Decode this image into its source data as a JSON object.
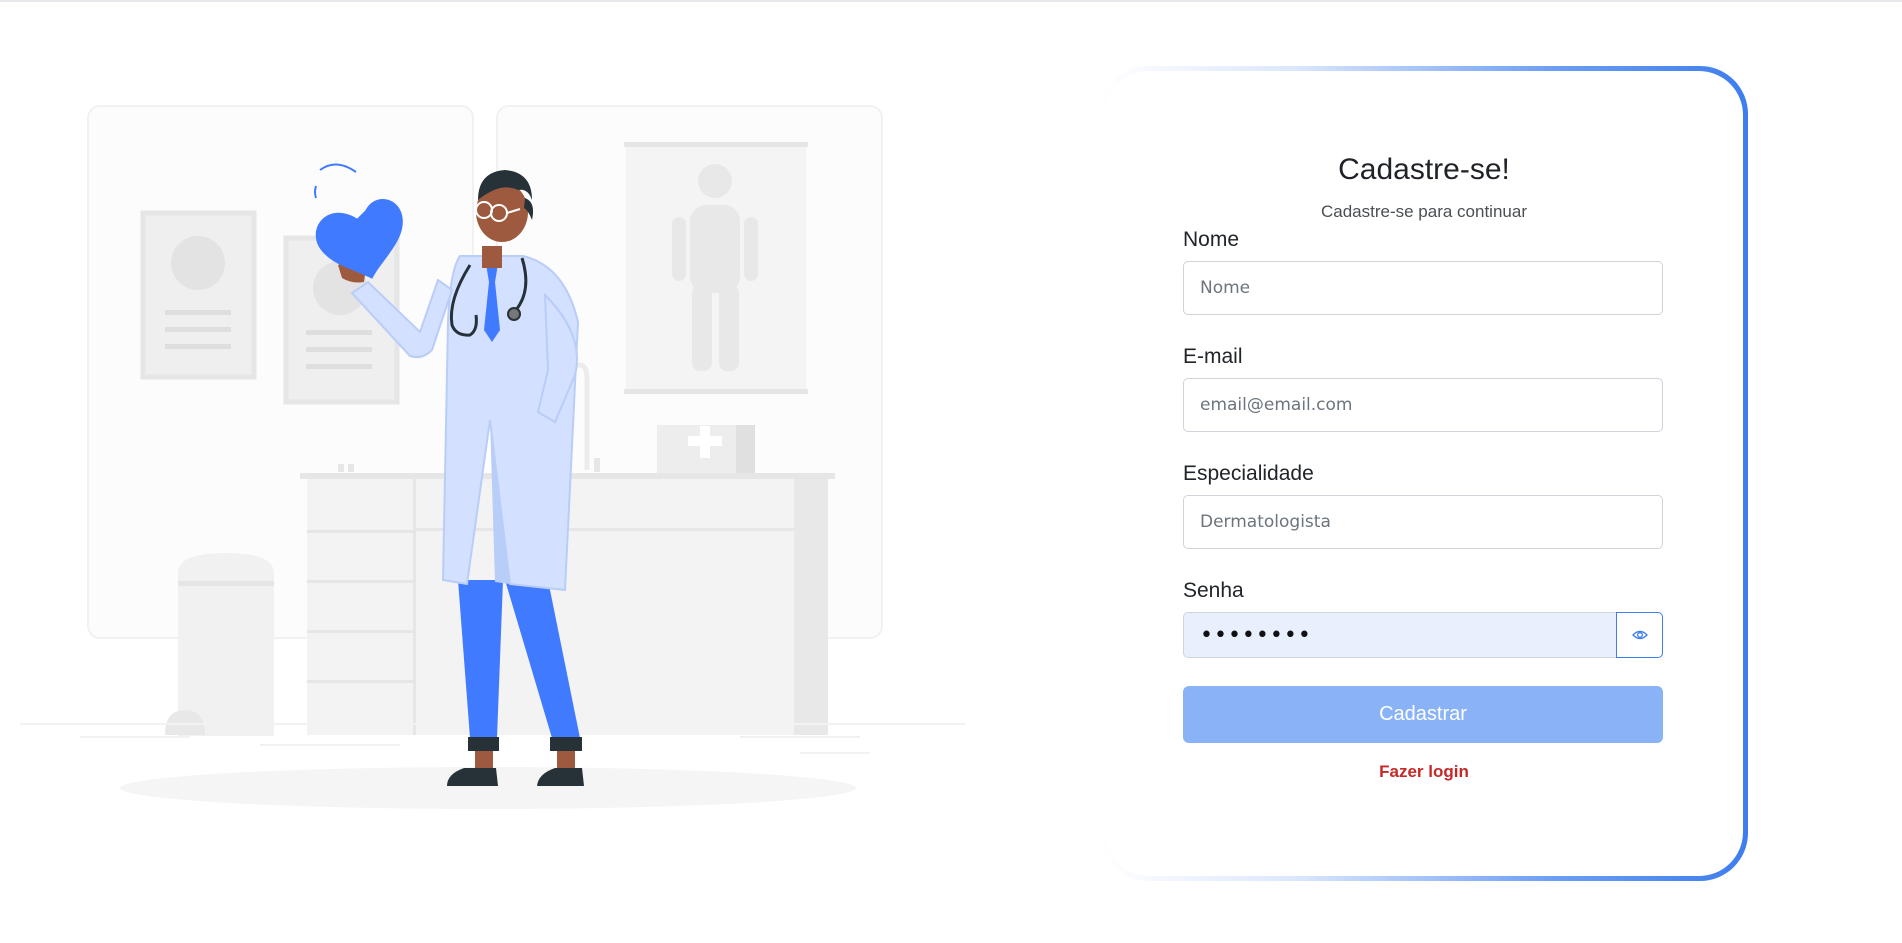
{
  "form": {
    "title": "Cadastre-se!",
    "subtitle": "Cadastre-se para continuar",
    "fields": {
      "nome": {
        "label": "Nome",
        "placeholder": "Nome",
        "value": ""
      },
      "email": {
        "label": "E-mail",
        "placeholder": "email@email.com",
        "value": ""
      },
      "especialidade": {
        "label": "Especialidade",
        "placeholder": "Dermatologista",
        "value": ""
      },
      "senha": {
        "label": "Senha",
        "value": "••••••••"
      }
    },
    "submit_label": "Cadastrar",
    "login_link": "Fazer login"
  },
  "icons": {
    "password_toggle": "eye-icon"
  },
  "colors": {
    "accent": "#3d7ded",
    "button": "#8ab3f7",
    "link": "#c62828",
    "illustration_blue": "#407bff"
  }
}
